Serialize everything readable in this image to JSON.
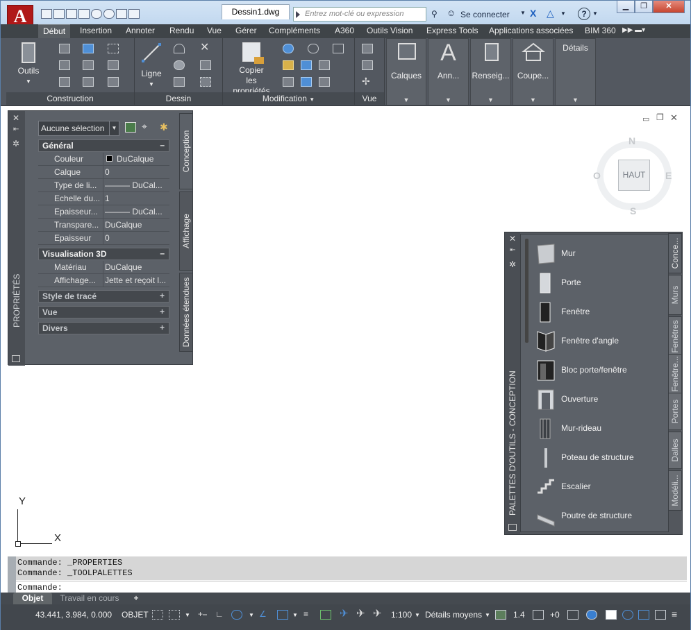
{
  "app": {
    "logo_letter": "A",
    "logo_sub": "A",
    "document_tab": "Dessin1.dwg",
    "search_placeholder": "Entrez mot-clé ou expression",
    "sign_in": "Se connecter",
    "help": "?"
  },
  "ribbon_tabs": [
    "Début",
    "Insertion",
    "Annoter",
    "Rendu",
    "Vue",
    "Gérer",
    "Compléments",
    "A360",
    "Outils Vision",
    "Express Tools",
    "Applications associées",
    "BIM 360"
  ],
  "ribbon": {
    "outils": "Outils",
    "construction": "Construction",
    "ligne": "Ligne",
    "dessin": "Dessin",
    "copier1": "Copier",
    "copier2": "les propriétés",
    "modification": "Modification",
    "vue": "Vue",
    "calques": "Calques",
    "ann": "Ann...",
    "renseig": "Renseig...",
    "coupe": "Coupe...",
    "details": "Détails"
  },
  "properties": {
    "palette_title": "PROPRIÉTÉS",
    "selection": "Aucune sélection",
    "tabs": [
      "Conception",
      "Affichage",
      "Données étendues"
    ],
    "general": "Général",
    "general_rows": [
      {
        "k": "Couleur",
        "v": "DuCalque"
      },
      {
        "k": "Calque",
        "v": "0"
      },
      {
        "k": "Type de li...",
        "v": "——— DuCal..."
      },
      {
        "k": "Echelle du...",
        "v": "1"
      },
      {
        "k": "Epaisseur...",
        "v": "——— DuCal..."
      },
      {
        "k": "Transpare...",
        "v": "DuCalque"
      },
      {
        "k": "Epaisseur",
        "v": "0"
      }
    ],
    "vis3d": "Visualisation 3D",
    "vis3d_rows": [
      {
        "k": "Matériau",
        "v": "DuCalque"
      },
      {
        "k": "Affichage...",
        "v": "Jette et reçoit l..."
      }
    ],
    "collapsed": [
      "Style de tracé",
      "Vue",
      "Divers"
    ],
    "minus": "–",
    "plus": "+"
  },
  "viewcube": {
    "n": "N",
    "e": "E",
    "s": "S",
    "o": "O",
    "top": "HAUT"
  },
  "tool_palette": {
    "title": "PALETTES D'OUTILS - CONCEPTION",
    "items": [
      "Mur",
      "Porte",
      "Fenêtre",
      "Fenêtre d'angle",
      "Bloc porte/fenêtre",
      "Ouverture",
      "Mur-rideau",
      "Poteau de structure",
      "Escalier",
      "Poutre de structure"
    ],
    "tabs": [
      "Conce...",
      "Murs",
      "Fenêtres",
      "Fenêtre...",
      "Portes",
      "Dalles",
      "Modéli..."
    ]
  },
  "ucs": {
    "x": "X",
    "y": "Y"
  },
  "command": {
    "history": [
      "Commande:  _PROPERTIES",
      "Commande:  _TOOLPALETTES"
    ],
    "prompt": "Commande:"
  },
  "layout_tabs": [
    "Objet",
    "Travail en cours",
    "+"
  ],
  "status": {
    "coords": "43.441, 3.984, 0.000",
    "mode": "OBJET",
    "scale": "1:100",
    "detail": "Détails moyens",
    "cut": "1.4",
    "elev": "+0"
  }
}
